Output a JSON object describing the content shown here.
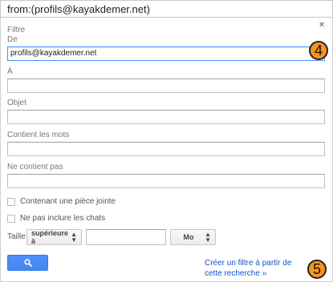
{
  "search_bar": {
    "query": "from:(profils@kayakdemer.net)"
  },
  "filter": {
    "title": "Filtre",
    "close_label": "×",
    "fields": {
      "from_label": "De",
      "from_value": "profils@kayakdemer.net",
      "to_label": "À",
      "to_value": "",
      "subject_label": "Objet",
      "subject_value": "",
      "has_words_label": "Contient les mots",
      "has_words_value": "",
      "doesnt_have_label": "Ne contient pas",
      "doesnt_have_value": ""
    },
    "checkboxes": {
      "has_attachment_label": "Contenant une pièce jointe",
      "has_attachment_checked": false,
      "no_chats_label": "Ne pas inclure les chats",
      "no_chats_checked": false
    },
    "size": {
      "label": "Taille",
      "operator_selected": "supérieure à",
      "value": "",
      "unit_selected": "Mo"
    },
    "search_button_icon": "search-icon",
    "create_filter_link": "Créer un filtre à partir de cette recherche »"
  },
  "annotations": {
    "callout_a": "4",
    "callout_b": "5",
    "callout_color": "#f7941d"
  }
}
